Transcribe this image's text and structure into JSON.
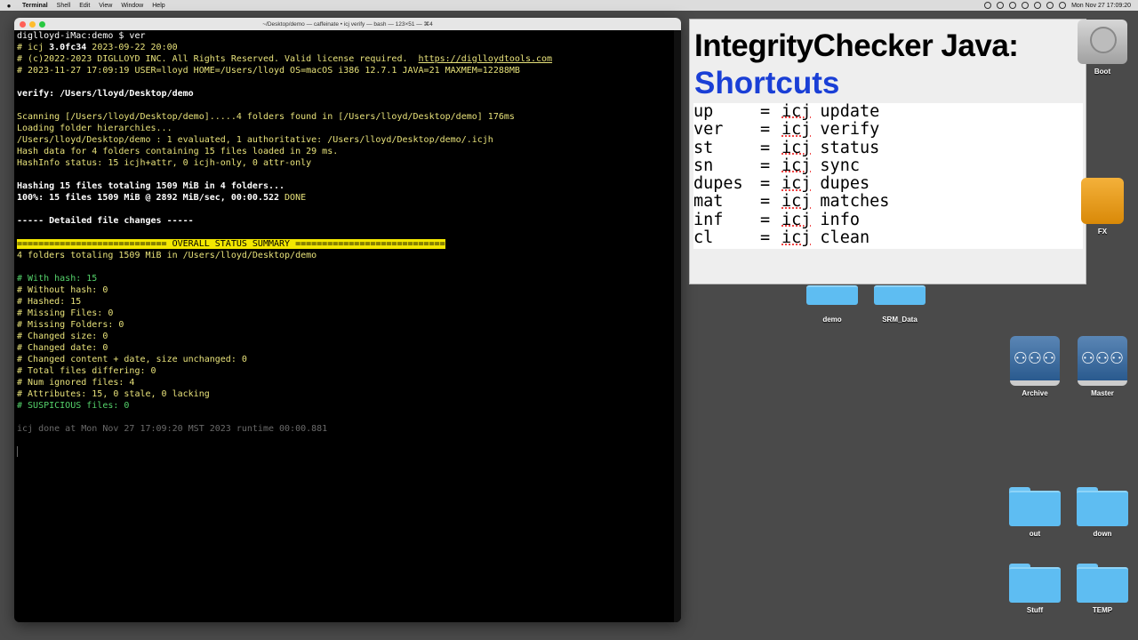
{
  "menubar": {
    "apple": "",
    "items": [
      "Terminal",
      "Shell",
      "Edit",
      "View",
      "Window",
      "Help"
    ],
    "clock": "Mon Nov 27  17:09:20"
  },
  "terminal": {
    "window_title": "~/Desktop/demo — caffeinate • icj verify — bash — 123×51 — ⌘4",
    "lines": [
      {
        "parts": [
          {
            "t": "diglloyd-iMac:demo $ ver",
            "c": "c-white"
          }
        ]
      },
      {
        "parts": [
          {
            "t": "# icj ",
            "c": "c-yel"
          },
          {
            "t": "3.0fc34",
            "c": "c-bold"
          },
          {
            "t": " 2023-09-22 20:00",
            "c": "c-yel"
          }
        ]
      },
      {
        "parts": [
          {
            "t": "# (c)2022-2023 DIGLLOYD INC. All Rights Reserved. Valid license required.  ",
            "c": "c-yel"
          },
          {
            "t": "https://diglloydtools.com",
            "c": "c-link"
          }
        ]
      },
      {
        "parts": [
          {
            "t": "# 2023-11-27 17:09:19 USER=lloyd HOME=/Users/lloyd OS=macOS i386 12.7.1 JAVA=21 MAXMEM=12288MB",
            "c": "c-yel"
          }
        ]
      },
      {
        "parts": [
          {
            "t": "",
            "c": "c-yel"
          }
        ]
      },
      {
        "parts": [
          {
            "t": "verify: /Users/lloyd/Desktop/demo",
            "c": "c-bold"
          }
        ]
      },
      {
        "parts": [
          {
            "t": "",
            "c": "c-yel"
          }
        ]
      },
      {
        "parts": [
          {
            "t": "Scanning [/Users/lloyd/Desktop/demo].....4 folders found in [/Users/lloyd/Desktop/demo] 176ms",
            "c": "c-yel"
          }
        ]
      },
      {
        "parts": [
          {
            "t": "Loading folder hierarchies...",
            "c": "c-yel"
          }
        ]
      },
      {
        "parts": [
          {
            "t": "/Users/lloyd/Desktop/demo : 1 evaluated, 1 authoritative: /Users/lloyd/Desktop/demo/.icjh",
            "c": "c-yel"
          }
        ]
      },
      {
        "parts": [
          {
            "t": "Hash data for 4 folders containing 15 files loaded in 29 ms.",
            "c": "c-yel"
          }
        ]
      },
      {
        "parts": [
          {
            "t": "HashInfo status: 15 icjh+attr, 0 icjh-only, 0 attr-only",
            "c": "c-yel"
          }
        ]
      },
      {
        "parts": [
          {
            "t": "",
            "c": "c-yel"
          }
        ]
      },
      {
        "parts": [
          {
            "t": "Hashing 15 files totaling 1509 MiB in 4 folders...",
            "c": "c-bold"
          }
        ]
      },
      {
        "parts": [
          {
            "t": "100%: 15 files 1509 MiB @ 2892 MiB/sec, 00:00.522 ",
            "c": "c-bold"
          },
          {
            "t": "DONE",
            "c": "c-yel"
          }
        ]
      },
      {
        "parts": [
          {
            "t": "",
            "c": "c-yel"
          }
        ]
      },
      {
        "parts": [
          {
            "t": "----- Detailed file changes -----",
            "c": "c-bold"
          }
        ]
      },
      {
        "parts": [
          {
            "t": "",
            "c": "c-yel"
          }
        ]
      },
      {
        "parts": [
          {
            "t": "============================ OVERALL STATUS SUMMARY ============================",
            "c": "banner"
          }
        ]
      },
      {
        "parts": [
          {
            "t": "4 folders totaling 1509 MiB in /Users/lloyd/Desktop/demo",
            "c": "c-yel"
          }
        ]
      },
      {
        "parts": [
          {
            "t": "",
            "c": "c-yel"
          }
        ]
      },
      {
        "parts": [
          {
            "t": "# With hash: 15",
            "c": "c-green"
          }
        ]
      },
      {
        "parts": [
          {
            "t": "# Without hash: 0",
            "c": "c-yel"
          }
        ]
      },
      {
        "parts": [
          {
            "t": "# Hashed: 15",
            "c": "c-yel"
          }
        ]
      },
      {
        "parts": [
          {
            "t": "# Missing Files: 0",
            "c": "c-yel"
          }
        ]
      },
      {
        "parts": [
          {
            "t": "# Missing Folders: 0",
            "c": "c-yel"
          }
        ]
      },
      {
        "parts": [
          {
            "t": "# Changed size: 0",
            "c": "c-yel"
          }
        ]
      },
      {
        "parts": [
          {
            "t": "# Changed date: 0",
            "c": "c-yel"
          }
        ]
      },
      {
        "parts": [
          {
            "t": "# Changed content + date, size unchanged: 0",
            "c": "c-yel"
          }
        ]
      },
      {
        "parts": [
          {
            "t": "# Total files differing: 0",
            "c": "c-yel"
          }
        ]
      },
      {
        "parts": [
          {
            "t": "# Num ignored files: 4",
            "c": "c-yel"
          }
        ]
      },
      {
        "parts": [
          {
            "t": "# Attributes: 15, 0 stale, 0 lacking",
            "c": "c-yel"
          }
        ]
      },
      {
        "parts": [
          {
            "t": "# SUSPICIOUS files: 0",
            "c": "c-green"
          }
        ]
      },
      {
        "parts": [
          {
            "t": "",
            "c": "c-yel"
          }
        ]
      },
      {
        "parts": [
          {
            "t": "icj done at Mon Nov 27 17:09:20 MST 2023 runtime 00:00.881",
            "c": "c-gray"
          }
        ]
      },
      {
        "parts": [
          {
            "t": "",
            "c": "c-yel"
          }
        ]
      }
    ]
  },
  "panel": {
    "title_line1": "IntegrityChecker Java:",
    "title_line2": "Shortcuts",
    "shortcuts": [
      {
        "key": "up",
        "eq": "=",
        "cmd": "icj",
        "arg": "update"
      },
      {
        "key": "ver",
        "eq": "=",
        "cmd": "icj",
        "arg": "verify"
      },
      {
        "key": "st",
        "eq": "=",
        "cmd": "icj",
        "arg": "status"
      },
      {
        "key": "sn",
        "eq": "=",
        "cmd": "icj",
        "arg": "sync"
      },
      {
        "key": "dupes",
        "eq": "=",
        "cmd": "icj",
        "arg": "dupes"
      },
      {
        "key": "mat",
        "eq": "=",
        "cmd": "icj",
        "arg": "matches"
      },
      {
        "key": "inf",
        "eq": "=",
        "cmd": "icj",
        "arg": "info"
      },
      {
        "key": "cl",
        "eq": "=",
        "cmd": "icj",
        "arg": "clean"
      }
    ]
  },
  "desktop": {
    "boot": "Boot",
    "fx": "FX",
    "demo": "demo",
    "srm": "SRM_Data",
    "archive": "Archive",
    "master": "Master",
    "out": "out",
    "down": "down",
    "stuff": "Stuff",
    "temp": "TEMP"
  }
}
